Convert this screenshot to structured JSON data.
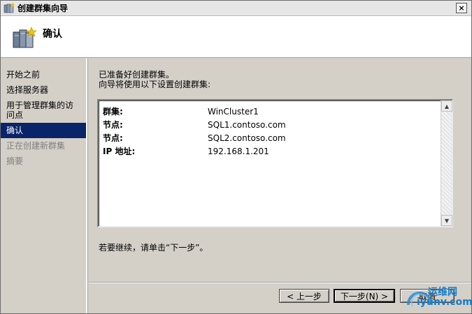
{
  "window": {
    "title": "创建群集向导",
    "close_glyph": "×"
  },
  "header": {
    "page_title": "确认"
  },
  "sidebar": {
    "items": [
      {
        "label": "开始之前"
      },
      {
        "label": "选择服务器"
      },
      {
        "label": "用于管理群集的访问点"
      },
      {
        "label": "确认"
      },
      {
        "label": "正在创建新群集"
      },
      {
        "label": "摘要"
      }
    ],
    "active_index": 3
  },
  "main": {
    "intro_line1": "已准备好创建群集。",
    "intro_line2": "向导将使用以下设置创建群集:",
    "settings": [
      {
        "key": "群集:",
        "value": "WinCluster1"
      },
      {
        "key": "节点:",
        "value": "SQL1.contoso.com"
      },
      {
        "key": "节点:",
        "value": "SQL2.contoso.com"
      },
      {
        "key": "IP 地址:",
        "value": "192.168.1.201"
      }
    ],
    "continue_text": "若要继续，请单击“下一步”。"
  },
  "buttons": {
    "back_label": "< 上一步",
    "next_label": "下一步(N) >",
    "cancel_label": "取消"
  },
  "watermark": {
    "line1": "运维网",
    "line2": "iyunv.com"
  }
}
